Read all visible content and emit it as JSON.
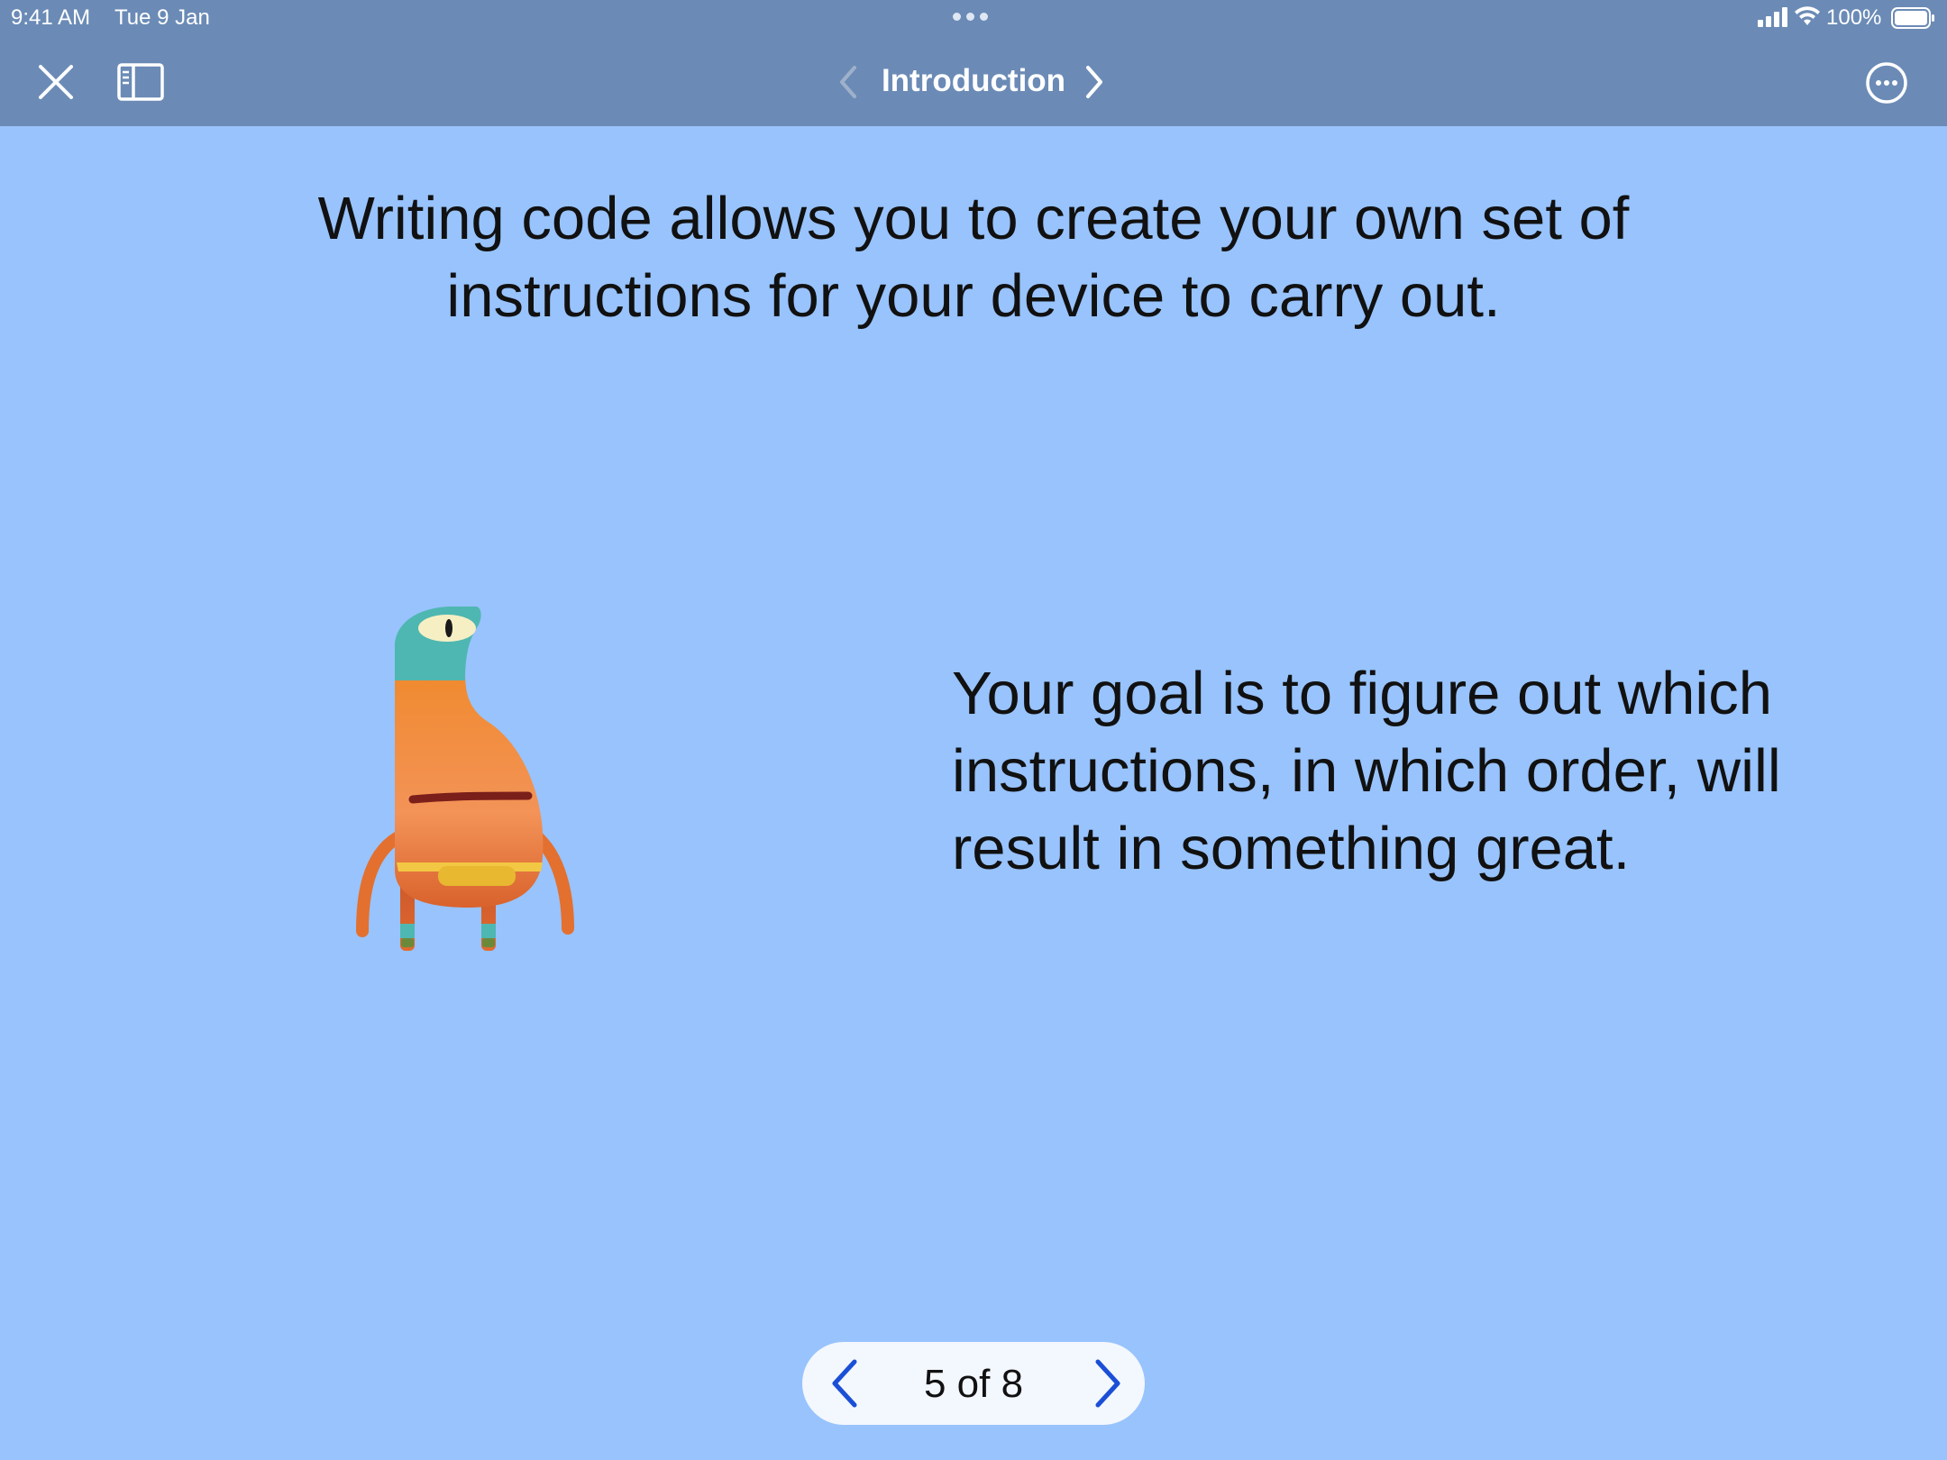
{
  "status_bar": {
    "time": "9:41 AM",
    "date": "Tue 9 Jan",
    "battery": "100%",
    "signal_icon": "signal-icon",
    "wifi_icon": "wifi-icon",
    "battery_icon": "battery-icon"
  },
  "nav": {
    "title": "Introduction",
    "close_icon": "close-icon",
    "sidebar_icon": "sidebar-toggle-icon",
    "prev_icon": "chevron-left-icon",
    "next_icon": "chevron-right-icon",
    "more_icon": "ellipsis-circle-icon"
  },
  "content": {
    "headline": "Writing code allows you to create your own set of instructions for your device to carry out.",
    "goal": "Your goal is to figure out which instructions, in which order, will result in something great.",
    "character_icon": "byte-character-illustration"
  },
  "pager": {
    "label": "5 of 8",
    "prev_icon": "chevron-left-icon",
    "next_icon": "chevron-right-icon"
  },
  "colors": {
    "top_bar": "#6b8bb6",
    "page_background": "#98c3fd",
    "pager_background": "#f3f7fe",
    "accent_blue": "#1a4fd6",
    "character_body": "#f0893a",
    "character_head": "#4fb7b1",
    "character_belt": "#f2c744"
  }
}
